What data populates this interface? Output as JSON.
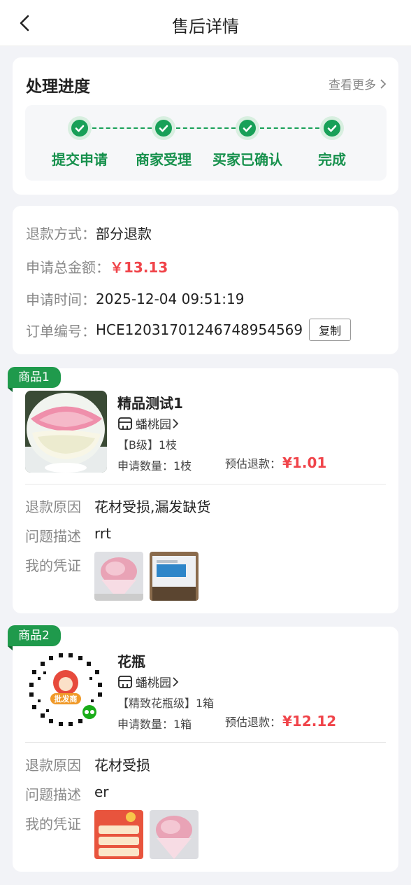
{
  "header": {
    "title": "售后详情"
  },
  "progress": {
    "title": "处理进度",
    "more_label": "查看更多",
    "steps": [
      "提交申请",
      "商家受理",
      "买家已确认",
      "完成"
    ]
  },
  "refund_info": {
    "method_label": "退款方式：",
    "method_value": "部分退款",
    "total_label": "申请总金额：",
    "total_value": "￥13.13",
    "time_label": "申请时间：",
    "time_value": "2025-12-04 09:51:19",
    "order_label": "订单编号：",
    "order_value": "HCE12031701246748954569",
    "copy_label": "复制"
  },
  "products": [
    {
      "badge": "商品1",
      "name": "精品测试1",
      "shop": "蟠桃园",
      "spec": "【B级】1枝",
      "qty": "申请数量：1枝",
      "est_label": "预估退款：",
      "est_value": "¥1.01",
      "reason_label": "退款原因",
      "reason_value": "花材受损,漏发缺货",
      "desc_label": "问题描述",
      "desc_value": "rrt",
      "evidence_label": "我的凭证"
    },
    {
      "badge": "商品2",
      "name": "花瓶",
      "shop": "蟠桃园",
      "spec": "【精致花瓶级】1箱",
      "qty": "申请数量：1箱",
      "est_label": "预估退款：",
      "est_value": "¥12.12",
      "reason_label": "退款原因",
      "reason_value": "花材受损",
      "desc_label": "问题描述",
      "desc_value": "er",
      "evidence_label": "我的凭证",
      "qr_badge": "批发商"
    }
  ],
  "colors": {
    "accent_green": "#18a058",
    "price_red": "#f0444a"
  }
}
